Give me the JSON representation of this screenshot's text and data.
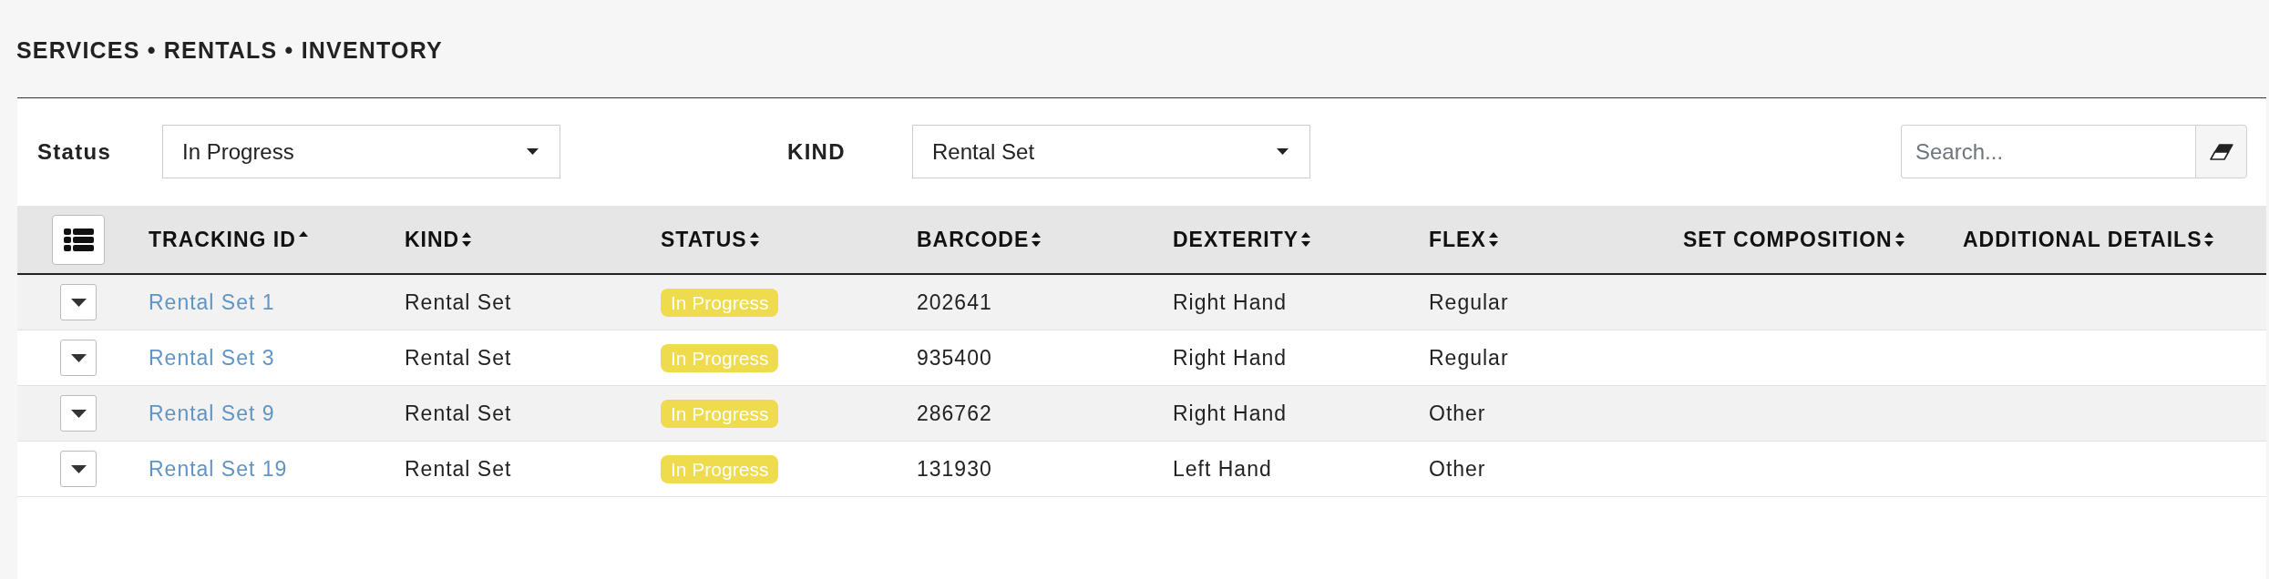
{
  "page_title": "SERVICES • RENTALS • INVENTORY",
  "filters": [
    {
      "label": "Status",
      "value": "In Progress"
    },
    {
      "label": "KIND",
      "value": "Rental Set"
    }
  ],
  "search": {
    "placeholder": "Search..."
  },
  "table": {
    "columns": [
      {
        "label": "TRACKING ID",
        "sorted": true
      },
      {
        "label": "KIND",
        "sorted": false
      },
      {
        "label": "STATUS",
        "sorted": false
      },
      {
        "label": "BARCODE",
        "sorted": false
      },
      {
        "label": "DEXTERITY",
        "sorted": false
      },
      {
        "label": "FLEX",
        "sorted": false
      },
      {
        "label": "SET COMPOSITION",
        "sorted": false
      },
      {
        "label": "ADDITIONAL DETAILS",
        "sorted": false
      }
    ],
    "rows": [
      {
        "tracking_id": "Rental Set 1",
        "kind": "Rental Set",
        "status": "In Progress",
        "barcode": "202641",
        "dexterity": "Right Hand",
        "flex": "Regular"
      },
      {
        "tracking_id": "Rental Set 3",
        "kind": "Rental Set",
        "status": "In Progress",
        "barcode": "935400",
        "dexterity": "Right Hand",
        "flex": "Regular"
      },
      {
        "tracking_id": "Rental Set 9",
        "kind": "Rental Set",
        "status": "In Progress",
        "barcode": "286762",
        "dexterity": "Right Hand",
        "flex": "Other"
      },
      {
        "tracking_id": "Rental Set 19",
        "kind": "Rental Set",
        "status": "In Progress",
        "barcode": "131930",
        "dexterity": "Left Hand",
        "flex": "Other"
      }
    ]
  }
}
